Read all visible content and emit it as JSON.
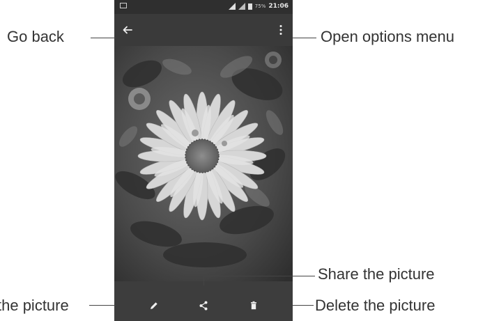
{
  "status_bar": {
    "time": "21:06",
    "battery": "75%"
  },
  "toolbar": {
    "back_icon": "arrow-left-icon",
    "menu_icon": "more-vertical-icon"
  },
  "actions": {
    "edit_icon": "pencil-icon",
    "share_icon": "share-icon",
    "delete_icon": "trash-icon"
  },
  "callouts": {
    "go_back": "Go back",
    "options_menu": "Open options menu",
    "share": "Share the picture",
    "edit": "the picture",
    "delete": "Delete the picture"
  },
  "colors": {
    "app_bar": "#3a3a3a",
    "bottom_bar": "#3d3d3d",
    "icon": "#f0f0f0",
    "label_text": "#333333"
  }
}
